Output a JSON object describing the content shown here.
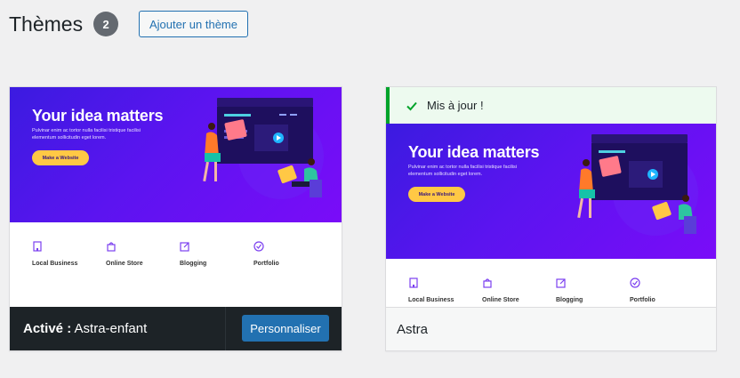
{
  "header": {
    "title": "Thèmes",
    "count": "2",
    "add_button": "Ajouter un thème"
  },
  "themes": [
    {
      "screenshot": {
        "hero_title": "Your idea matters",
        "hero_subtitle": "Pulvinar enim ac tortor nulla facilisi tristique facilisi elementum sollicitudin eget lorem.",
        "hero_button": "Make a Website",
        "features": [
          "Local Business",
          "Online Store",
          "Blogging",
          "Portfolio"
        ]
      },
      "active_prefix": "Activé :",
      "name": "Astra-enfant",
      "customize_button": "Personnaliser"
    },
    {
      "notice": "Mis à jour !",
      "screenshot": {
        "hero_title": "Your idea matters",
        "hero_subtitle": "Pulvinar enim ac tortor nulla facilisi tristique facilisi elementum sollicitudin eget lorem.",
        "hero_button": "Make a Website",
        "features": [
          "Local Business",
          "Online Store",
          "Blogging",
          "Portfolio"
        ]
      },
      "name": "Astra"
    }
  ],
  "colors": {
    "accent": "#2271b1",
    "success": "#00a32a",
    "hero_start": "#3b1be0",
    "hero_end": "#7a0cf8",
    "cta": "#ffc845"
  }
}
